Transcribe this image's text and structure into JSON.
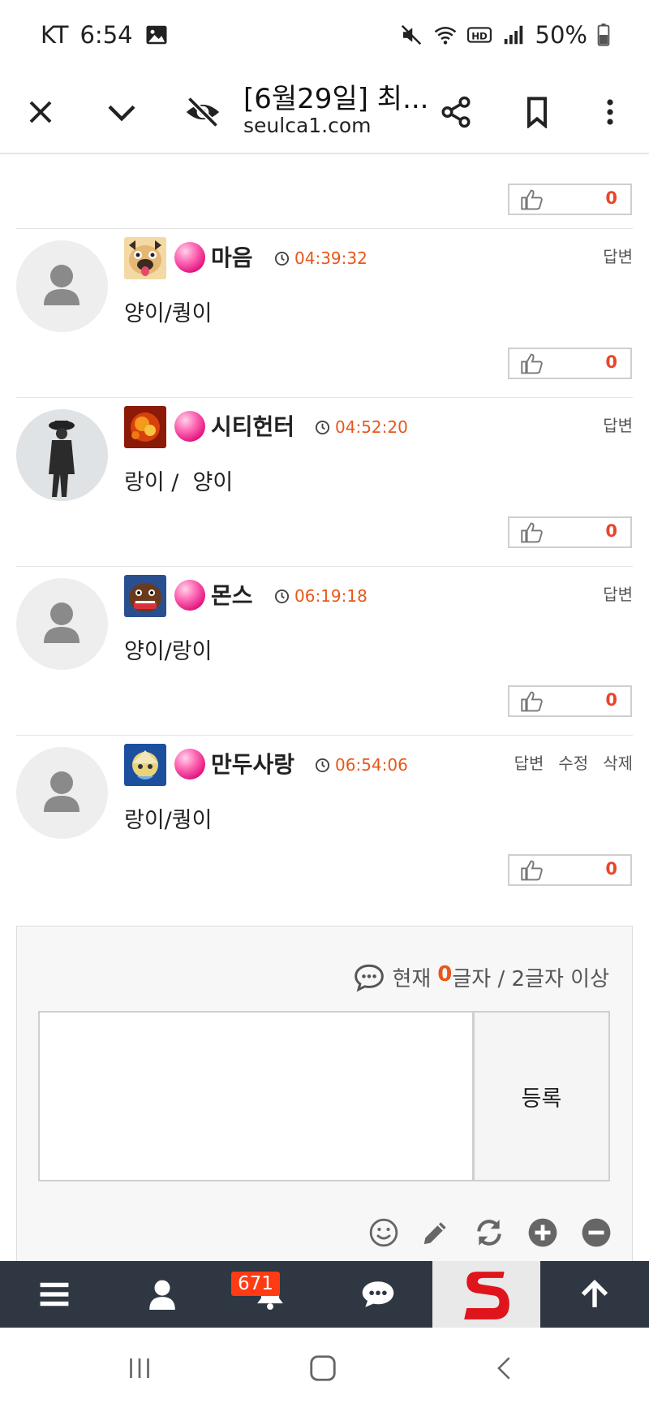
{
  "status_bar": {
    "carrier": "KT",
    "time": "6:54",
    "battery": "50%"
  },
  "browser": {
    "title": "[6월29일] 최...",
    "url": "seulca1.com"
  },
  "comments": [
    {
      "nick": "마음",
      "time": "04:39:32",
      "text": "양이/퀑이",
      "likes": "0",
      "actions": [
        "답변"
      ]
    },
    {
      "nick": "시티헌터",
      "time": "04:52:20",
      "text": "랑이 /  양이",
      "likes": "0",
      "actions": [
        "답변"
      ]
    },
    {
      "nick": "몬스",
      "time": "06:19:18",
      "text": "양이/랑이",
      "likes": "0",
      "actions": [
        "답변"
      ]
    },
    {
      "nick": "만두사랑",
      "time": "06:54:06",
      "text": "랑이/퀑이",
      "likes": "0",
      "actions": [
        "답변",
        "수정",
        "삭제"
      ]
    }
  ],
  "top_like": "0",
  "write": {
    "counter_prefix": "현재",
    "counter_value": "0",
    "counter_suffix": "글자 / 2글자 이상",
    "submit_label": "등록"
  },
  "bottom_nav": {
    "notification_count": "671"
  },
  "colors": {
    "accent": "#e8571b",
    "like_count": "#e8452d",
    "nav_bg": "#2f3742"
  }
}
